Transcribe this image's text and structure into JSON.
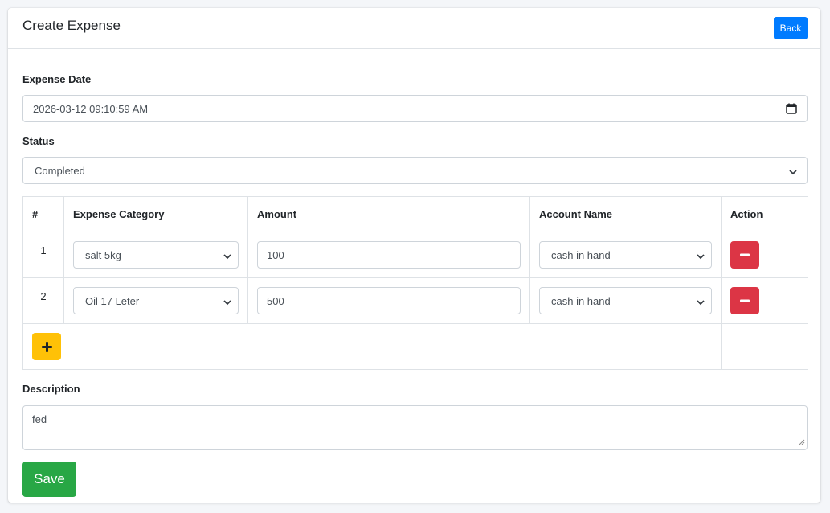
{
  "header": {
    "title": "Create Expense",
    "back_label": "Back"
  },
  "form": {
    "expense_date": {
      "label": "Expense Date",
      "value": "2026-03-12 09:10:59 AM"
    },
    "status": {
      "label": "Status",
      "value": "Completed"
    },
    "table": {
      "headers": [
        "#",
        "Expense Category",
        "Amount",
        "Account Name",
        "Action"
      ],
      "rows": [
        {
          "num": "1",
          "category": "salt 5kg",
          "amount": "100",
          "account": "cash in hand"
        },
        {
          "num": "2",
          "category": "Oil 17 Leter",
          "amount": "500",
          "account": "cash in hand"
        }
      ]
    },
    "description": {
      "label": "Description",
      "value": "fed"
    },
    "save_label": "Save"
  },
  "colors": {
    "primary": "#007bff",
    "danger": "#dc3545",
    "warning": "#ffc107",
    "success": "#28a745"
  },
  "icons": {
    "calendar": "calendar-icon",
    "chevron": "chevron-down-icon",
    "minus": "minus-icon",
    "plus": "plus-icon"
  }
}
